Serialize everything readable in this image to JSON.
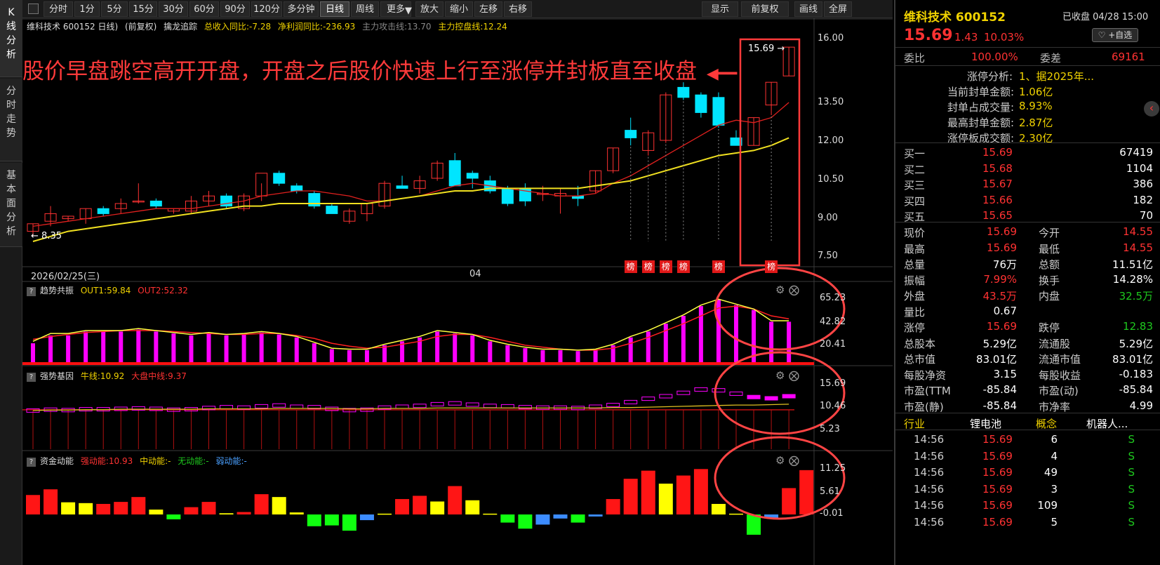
{
  "left_tabs": [
    "K线分析",
    "分时走势",
    "基本面分析"
  ],
  "toolbar": {
    "periods": [
      "分时",
      "1分",
      "5分",
      "15分",
      "30分",
      "60分",
      "90分",
      "120分",
      "多分钟",
      "日线",
      "周线",
      "更多"
    ],
    "actions": [
      "放大",
      "缩小",
      "左移",
      "右移"
    ],
    "right": [
      "显示",
      "前复权",
      "画线",
      "全屏"
    ],
    "active_period": "日线",
    "dropdown_arrow": "▼"
  },
  "chart_header": {
    "title": "维科技术 600152 日线)",
    "fq": "(前复权)",
    "indicator": "擒龙追踪",
    "rev": "总收入同比:-7.28",
    "profit": "净利润同比:-236.93",
    "attack": "主力攻击线:13.70",
    "control": "主力控盘线:12.24"
  },
  "annotation": "股价早盘跳空高开开盘，开盘之后股价快速上行至涨停并封板直至收盘",
  "annotation_arrow": "◀━━",
  "price_axis": [
    "16.00",
    "13.50",
    "12.00",
    "10.50",
    "9.00",
    "7.50"
  ],
  "high_label": "15.69",
  "low_label": "8.35",
  "date_label": "2026/02/25(三)",
  "month_label": "04",
  "rank_label": "榜",
  "panel2": {
    "title": "趋势共振",
    "out1": "OUT1:59.84",
    "out2": "OUT2:52.32",
    "axis": [
      "65.23",
      "42.82",
      "20.41"
    ]
  },
  "panel3": {
    "title": "强势基因",
    "bull": "牛线:10.92",
    "mid": "大盘中线:9.37",
    "axis": [
      "15.69",
      "10.46",
      "5.23"
    ]
  },
  "panel4": {
    "title": "资金动能",
    "strong": "强动能:10.93",
    "medium": "中动能:-",
    "none": "无动能:-",
    "weak": "弱动能:-",
    "axis": [
      "11.25",
      "5.61",
      "-0.01"
    ]
  },
  "panel_help": "?",
  "gear_icon": "⚙",
  "close_icon": "⨂",
  "stock": {
    "name": "维科技术",
    "code": "600152",
    "status": "已收盘 04/28 15:00",
    "price": "15.69",
    "change": "1.43",
    "change_pct": "10.03%",
    "fav": "♡ +自选",
    "collapse_icon": "‹"
  },
  "weibi": {
    "label1": "委比",
    "val1": "100.00%",
    "label2": "委差",
    "val2": "69161"
  },
  "limit_analysis": [
    {
      "label": "涨停分析:",
      "value": "1、据2025年..."
    },
    {
      "label": "当前封单金额:",
      "value": "1.06亿"
    },
    {
      "label": "封单占成交量:",
      "value": "8.93%"
    },
    {
      "label": "最高封单金额:",
      "value": "2.87亿"
    },
    {
      "label": "涨停板成交额:",
      "value": "2.30亿"
    }
  ],
  "bids": [
    {
      "label": "买一",
      "price": "15.69",
      "vol": "67419"
    },
    {
      "label": "买二",
      "price": "15.68",
      "vol": "1104"
    },
    {
      "label": "买三",
      "price": "15.67",
      "vol": "386"
    },
    {
      "label": "买四",
      "price": "15.66",
      "vol": "182"
    },
    {
      "label": "买五",
      "price": "15.65",
      "vol": "70"
    }
  ],
  "quote": [
    {
      "l1": "现价",
      "v1": "15.69",
      "c1": "red",
      "l2": "今开",
      "v2": "14.55",
      "c2": "red"
    },
    {
      "l1": "最高",
      "v1": "15.69",
      "c1": "red",
      "l2": "最低",
      "v2": "14.55",
      "c2": "red"
    },
    {
      "l1": "总量",
      "v1": "76万",
      "c1": "white",
      "l2": "总额",
      "v2": "11.51亿",
      "c2": "white"
    },
    {
      "l1": "振幅",
      "v1": "7.99%",
      "c1": "red",
      "l2": "换手",
      "v2": "14.28%",
      "c2": "white"
    },
    {
      "l1": "外盘",
      "v1": "43.5万",
      "c1": "red",
      "l2": "内盘",
      "v2": "32.5万",
      "c2": "green"
    },
    {
      "l1": "量比",
      "v1": "0.67",
      "c1": "white",
      "l2": "",
      "v2": "",
      "c2": "white"
    },
    {
      "l1": "涨停",
      "v1": "15.69",
      "c1": "red",
      "l2": "跌停",
      "v2": "12.83",
      "c2": "green"
    },
    {
      "l1": "总股本",
      "v1": "5.29亿",
      "c1": "white",
      "l2": "流通股",
      "v2": "5.29亿",
      "c2": "white"
    },
    {
      "l1": "总市值",
      "v1": "83.01亿",
      "c1": "white",
      "l2": "流通市值",
      "v2": "83.01亿",
      "c2": "white"
    },
    {
      "l1": "每股净资",
      "v1": "3.15",
      "c1": "white",
      "l2": "每股收益",
      "v2": "-0.183",
      "c2": "white"
    },
    {
      "l1": "市盈(TTM",
      "v1": "-85.84",
      "c1": "white",
      "l2": "市盈(动)",
      "v2": "-85.84",
      "c2": "white"
    },
    {
      "l1": "市盈(静)",
      "v1": "-85.84",
      "c1": "white",
      "l2": "市净率",
      "v2": "4.99",
      "c2": "white"
    }
  ],
  "industry": {
    "label": "行业",
    "value": "锂电池",
    "label2": "概念",
    "value2": "机器人..."
  },
  "ticks": [
    {
      "time": "14:56",
      "price": "15.69",
      "vol": "6",
      "side": "S"
    },
    {
      "time": "14:56",
      "price": "15.69",
      "vol": "4",
      "side": "S"
    },
    {
      "time": "14:56",
      "price": "15.69",
      "vol": "49",
      "side": "S"
    },
    {
      "time": "14:56",
      "price": "15.69",
      "vol": "3",
      "side": "S"
    },
    {
      "time": "14:56",
      "price": "15.69",
      "vol": "109",
      "side": "S"
    },
    {
      "time": "14:56",
      "price": "15.69",
      "vol": "5",
      "side": "S"
    }
  ],
  "colors": {
    "up": "#ff3232",
    "down": "#00e5ff",
    "ma5": "#e0201e",
    "ma20": "#f0e020",
    "bg": "#000000",
    "annotation": "#ff3a3a"
  },
  "chart_data": [
    {
      "type": "candlestick",
      "title": "维科技术 600152 日线",
      "ylim": [
        7.5,
        16.0
      ],
      "candles": [
        {
          "o": 8.4,
          "h": 8.7,
          "l": 8.2,
          "c": 8.7
        },
        {
          "o": 8.8,
          "h": 9.4,
          "l": 8.6,
          "c": 9.1
        },
        {
          "o": 8.9,
          "h": 9.0,
          "l": 8.8,
          "c": 9.0
        },
        {
          "o": 8.9,
          "h": 9.3,
          "l": 8.7,
          "c": 9.3
        },
        {
          "o": 9.3,
          "h": 9.4,
          "l": 9.0,
          "c": 9.1
        },
        {
          "o": 9.3,
          "h": 9.7,
          "l": 9.1,
          "c": 9.5
        },
        {
          "o": 9.6,
          "h": 10.3,
          "l": 9.5,
          "c": 9.6
        },
        {
          "o": 9.6,
          "h": 9.7,
          "l": 9.3,
          "c": 9.4
        },
        {
          "o": 9.2,
          "h": 9.3,
          "l": 9.1,
          "c": 9.3
        },
        {
          "o": 9.2,
          "h": 9.8,
          "l": 9.1,
          "c": 9.6
        },
        {
          "o": 9.6,
          "h": 10.0,
          "l": 9.4,
          "c": 9.8
        },
        {
          "o": 9.8,
          "h": 9.9,
          "l": 9.3,
          "c": 9.4
        },
        {
          "o": 9.3,
          "h": 9.9,
          "l": 9.2,
          "c": 9.8
        },
        {
          "o": 9.8,
          "h": 10.3,
          "l": 9.6,
          "c": 10.7
        },
        {
          "o": 10.7,
          "h": 10.8,
          "l": 10.2,
          "c": 10.3
        },
        {
          "o": 10.2,
          "h": 10.3,
          "l": 9.9,
          "c": 10.0
        },
        {
          "o": 9.9,
          "h": 10.0,
          "l": 9.3,
          "c": 9.4
        },
        {
          "o": 9.4,
          "h": 9.5,
          "l": 9.1,
          "c": 9.1
        },
        {
          "o": 8.8,
          "h": 9.3,
          "l": 8.7,
          "c": 9.2
        },
        {
          "o": 9.1,
          "h": 9.5,
          "l": 8.8,
          "c": 9.5
        },
        {
          "o": 9.4,
          "h": 10.4,
          "l": 9.3,
          "c": 10.3
        },
        {
          "o": 10.2,
          "h": 10.6,
          "l": 10.1,
          "c": 10.1
        },
        {
          "o": 10.1,
          "h": 10.6,
          "l": 9.9,
          "c": 10.4
        },
        {
          "o": 10.5,
          "h": 11.2,
          "l": 10.4,
          "c": 11.1
        },
        {
          "o": 11.2,
          "h": 11.5,
          "l": 10.2,
          "c": 10.2
        },
        {
          "o": 10.7,
          "h": 10.8,
          "l": 10.1,
          "c": 10.5
        },
        {
          "o": 10.4,
          "h": 10.6,
          "l": 9.9,
          "c": 10.0
        },
        {
          "o": 10.1,
          "h": 10.2,
          "l": 9.4,
          "c": 9.5
        },
        {
          "o": 10.1,
          "h": 10.3,
          "l": 9.4,
          "c": 9.6
        },
        {
          "o": 9.9,
          "h": 10.2,
          "l": 9.6,
          "c": 9.9
        },
        {
          "o": 9.8,
          "h": 10.1,
          "l": 9.1,
          "c": 9.9
        },
        {
          "o": 9.8,
          "h": 10.2,
          "l": 9.4,
          "c": 9.7
        },
        {
          "o": 10.0,
          "h": 10.8,
          "l": 9.9,
          "c": 10.8
        },
        {
          "o": 10.8,
          "h": 11.7,
          "l": 10.7,
          "c": 11.7
        },
        {
          "o": 12.4,
          "h": 12.9,
          "l": 11.8,
          "c": 12.1
        },
        {
          "o": 11.6,
          "h": 12.4,
          "l": 11.4,
          "c": 12.3
        },
        {
          "o": 12.0,
          "h": 13.9,
          "l": 11.9,
          "c": 13.8
        },
        {
          "o": 14.1,
          "h": 14.3,
          "l": 13.6,
          "c": 13.7
        },
        {
          "o": 13.8,
          "h": 13.9,
          "l": 12.9,
          "c": 13.1
        },
        {
          "o": 13.7,
          "h": 13.9,
          "l": 12.5,
          "c": 12.6
        },
        {
          "o": 12.1,
          "h": 12.4,
          "l": 11.8,
          "c": 11.8
        },
        {
          "o": 11.8,
          "h": 12.9,
          "l": 11.8,
          "c": 12.9
        },
        {
          "o": 13.4,
          "h": 14.3,
          "l": 13.0,
          "c": 14.3
        },
        {
          "o": 14.55,
          "h": 15.69,
          "l": 14.55,
          "c": 15.69
        }
      ],
      "ma_short": [
        8.6,
        8.7,
        8.8,
        8.9,
        9.0,
        9.1,
        9.2,
        9.3,
        9.3,
        9.3,
        9.4,
        9.5,
        9.6,
        9.8,
        9.9,
        10.0,
        10.0,
        9.9,
        9.8,
        9.6,
        9.6,
        9.7,
        9.8,
        10.0,
        10.2,
        10.3,
        10.2,
        10.1,
        10.0,
        9.9,
        9.8,
        9.8,
        9.9,
        10.3,
        10.6,
        11.0,
        11.4,
        11.8,
        12.2,
        12.6,
        12.8,
        12.7,
        12.9,
        13.5
      ],
      "ma_long": [
        8.0,
        8.2,
        8.4,
        8.5,
        8.6,
        8.7,
        8.8,
        8.9,
        9.0,
        9.1,
        9.2,
        9.3,
        9.4,
        9.4,
        9.5,
        9.5,
        9.5,
        9.5,
        9.5,
        9.5,
        9.6,
        9.7,
        9.8,
        9.9,
        10.0,
        10.0,
        10.1,
        10.1,
        10.1,
        10.1,
        10.1,
        10.1,
        10.2,
        10.3,
        10.4,
        10.6,
        10.8,
        11.0,
        11.2,
        11.4,
        11.5,
        11.6,
        11.8,
        12.1
      ],
      "rank_indices": [
        34,
        35,
        36,
        37,
        39,
        42
      ]
    },
    {
      "type": "bar",
      "title": "趋势共振",
      "ylim": [
        0,
        65.23
      ],
      "values": [
        20,
        28,
        28,
        32,
        32,
        32,
        34,
        32,
        30,
        28,
        30,
        28,
        29,
        31,
        29,
        26,
        20,
        14,
        13,
        13,
        18,
        22,
        26,
        32,
        30,
        28,
        22,
        18,
        15,
        13,
        13,
        12,
        13,
        18,
        26,
        32,
        40,
        48,
        58,
        65,
        59,
        54,
        42,
        42,
        46,
        56
      ],
      "out1": [
        22,
        30,
        30,
        33,
        33,
        33,
        35,
        33,
        31,
        29,
        31,
        29,
        30,
        32,
        30,
        27,
        21,
        15,
        14,
        14,
        19,
        23,
        27,
        33,
        31,
        29,
        23,
        19,
        16,
        14,
        14,
        13,
        14,
        19,
        27,
        33,
        41,
        49,
        59,
        65,
        60,
        55,
        43,
        43,
        47,
        58
      ],
      "out2": [
        24,
        27,
        29,
        31,
        32,
        33,
        33,
        33,
        32,
        31,
        30,
        29,
        29,
        30,
        30,
        28,
        25,
        20,
        17,
        15,
        16,
        19,
        22,
        27,
        29,
        29,
        26,
        22,
        18,
        16,
        14,
        13,
        13,
        15,
        20,
        26,
        33,
        40,
        48,
        56,
        58,
        55,
        48,
        45,
        46,
        52
      ]
    },
    {
      "type": "bar",
      "title": "强势基因",
      "ylim": [
        0,
        15.69
      ],
      "values": [
        9.2,
        9.4,
        9.3,
        9.5,
        9.5,
        9.6,
        9.7,
        9.6,
        9.4,
        9.5,
        9.8,
        10.0,
        9.9,
        10.2,
        10.4,
        10.1,
        10.0,
        9.6,
        9.3,
        9.4,
        9.9,
        10.1,
        10.3,
        10.7,
        10.9,
        10.6,
        10.3,
        10.2,
        10.0,
        9.9,
        9.9,
        9.8,
        10.1,
        10.5,
        11.2,
        12.0,
        12.6,
        13.4,
        14.2,
        14.0,
        13.2,
        12.4,
        12.1,
        12.6,
        14.0,
        15.5
      ],
      "bull_line": [
        9.2,
        9.3,
        9.3,
        9.4,
        9.4,
        9.5,
        9.5,
        9.5,
        9.5,
        9.5,
        9.6,
        9.6,
        9.6,
        9.6,
        9.7,
        9.7,
        9.7,
        9.7,
        9.6,
        9.6,
        9.7,
        9.7,
        9.7,
        9.8,
        9.8,
        9.8,
        9.8,
        9.8,
        9.8,
        9.8,
        9.8,
        9.8,
        9.8,
        9.9,
        9.9,
        10.0,
        10.1,
        10.2,
        10.3,
        10.4,
        10.5,
        10.5,
        10.6,
        10.7,
        10.8,
        10.92
      ]
    },
    {
      "type": "bar",
      "title": "资金动能",
      "ylim": [
        -3,
        11.25
      ],
      "values": [
        {
          "v": 4.8,
          "c": "red"
        },
        {
          "v": 6.2,
          "c": "red"
        },
        {
          "v": 3.0,
          "c": "yellow"
        },
        {
          "v": 2.8,
          "c": "yellow"
        },
        {
          "v": 2.6,
          "c": "red"
        },
        {
          "v": 3.1,
          "c": "red"
        },
        {
          "v": 4.3,
          "c": "red"
        },
        {
          "v": 1.2,
          "c": "yellow"
        },
        {
          "v": -1.2,
          "c": "green"
        },
        {
          "v": 1.8,
          "c": "red"
        },
        {
          "v": 3.1,
          "c": "red"
        },
        {
          "v": 0.3,
          "c": "yellow"
        },
        {
          "v": 0.6,
          "c": "red"
        },
        {
          "v": 5.0,
          "c": "red"
        },
        {
          "v": 4.3,
          "c": "yellow"
        },
        {
          "v": 0.5,
          "c": "yellow"
        },
        {
          "v": -2.9,
          "c": "green"
        },
        {
          "v": -2.7,
          "c": "green"
        },
        {
          "v": -4.0,
          "c": "green"
        },
        {
          "v": -1.4,
          "c": "blue"
        },
        {
          "v": 0.2,
          "c": "yellow"
        },
        {
          "v": 3.8,
          "c": "red"
        },
        {
          "v": 4.6,
          "c": "red"
        },
        {
          "v": 3.2,
          "c": "yellow"
        },
        {
          "v": 7.0,
          "c": "red"
        },
        {
          "v": 3.5,
          "c": "yellow"
        },
        {
          "v": 0.2,
          "c": "yellow"
        },
        {
          "v": -2.0,
          "c": "green"
        },
        {
          "v": -3.5,
          "c": "green"
        },
        {
          "v": -2.5,
          "c": "blue"
        },
        {
          "v": -1.0,
          "c": "blue"
        },
        {
          "v": -2.0,
          "c": "green"
        },
        {
          "v": -0.5,
          "c": "blue"
        },
        {
          "v": 3.8,
          "c": "red"
        },
        {
          "v": 8.8,
          "c": "red"
        },
        {
          "v": 10.8,
          "c": "red"
        },
        {
          "v": 7.6,
          "c": "yellow"
        },
        {
          "v": 9.6,
          "c": "red"
        },
        {
          "v": 11.2,
          "c": "red"
        },
        {
          "v": 2.6,
          "c": "yellow"
        },
        {
          "v": 0.2,
          "c": "yellow"
        },
        {
          "v": -5.0,
          "c": "green"
        },
        {
          "v": -1.0,
          "c": "blue"
        },
        {
          "v": 6.5,
          "c": "red"
        },
        {
          "v": 10.93,
          "c": "red"
        }
      ]
    }
  ]
}
